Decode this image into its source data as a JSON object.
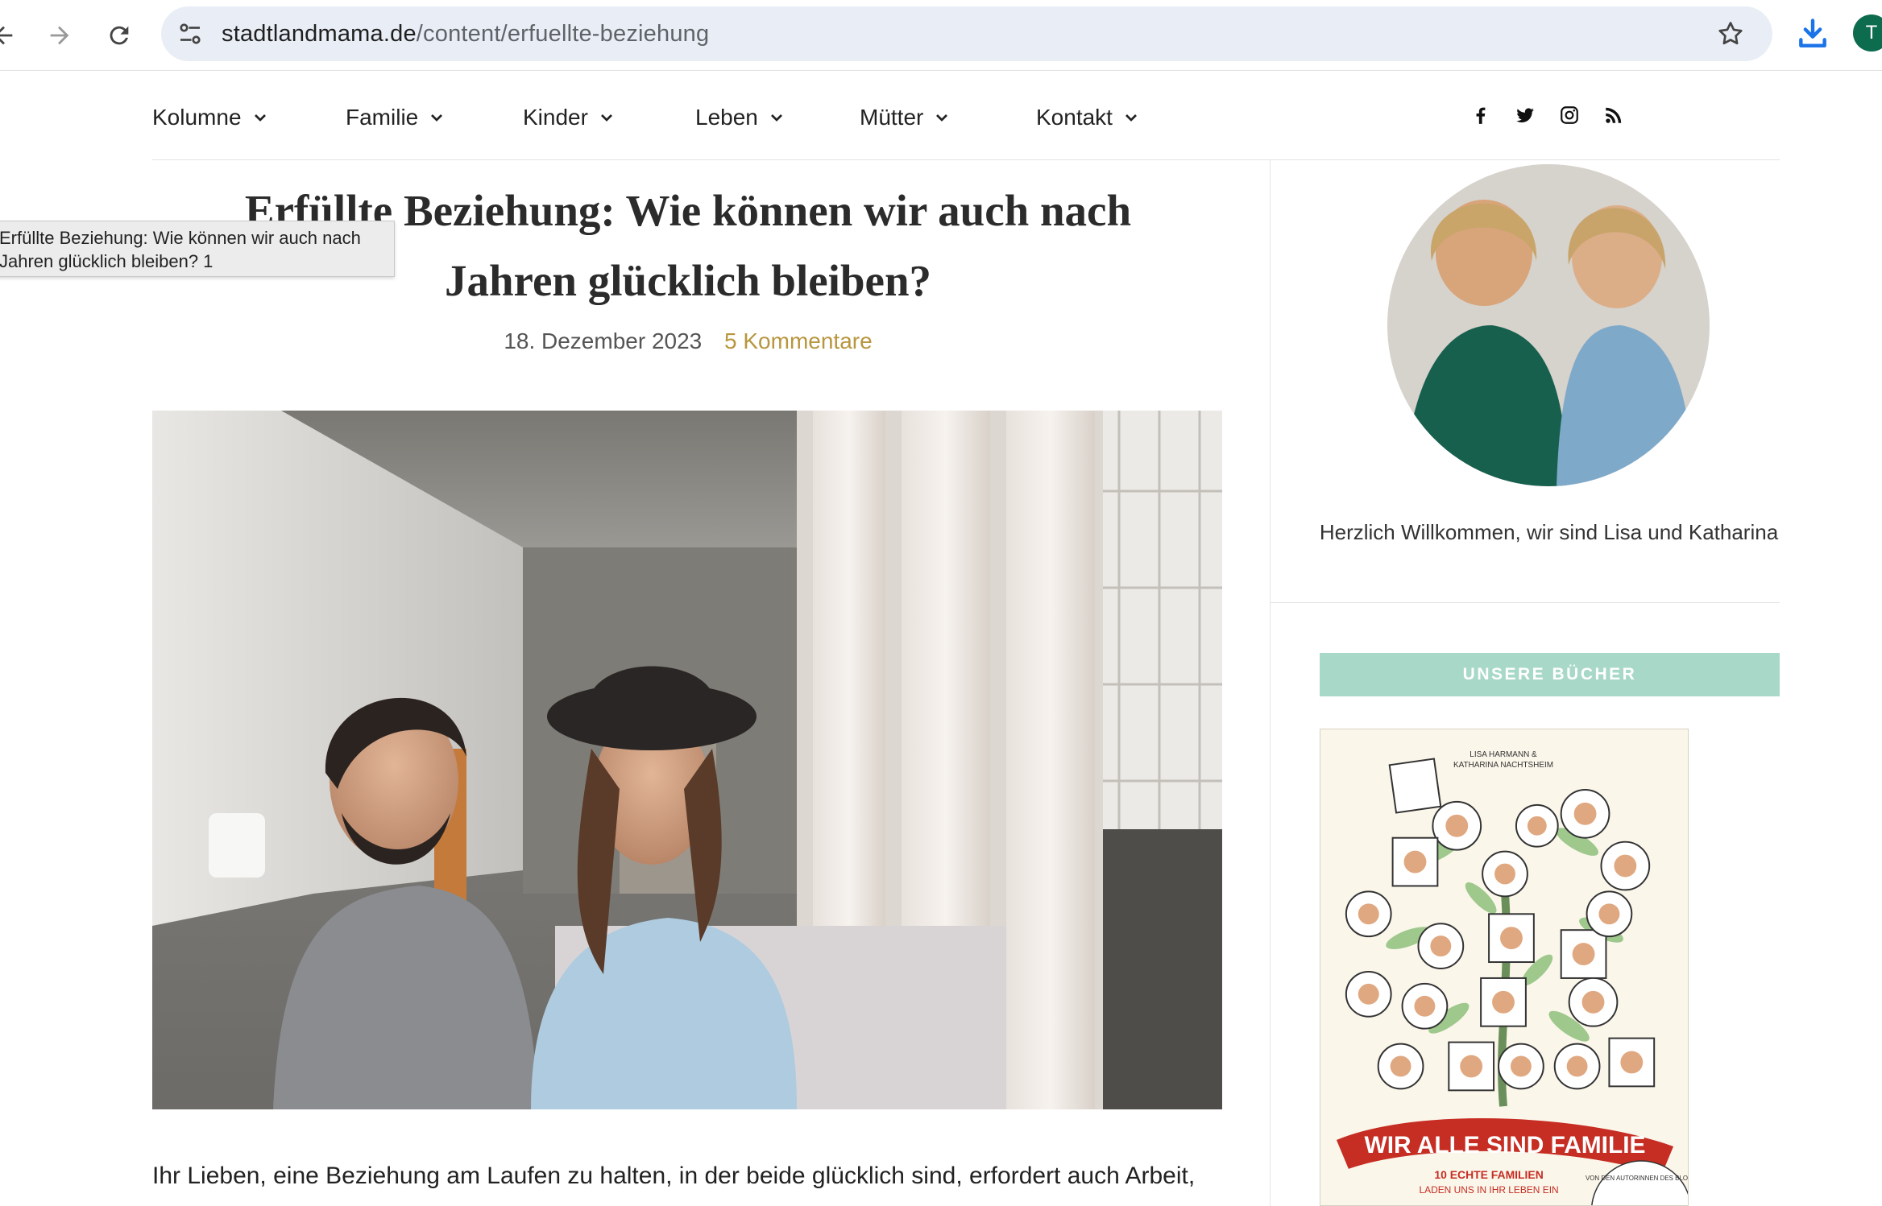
{
  "browser": {
    "url_domain": "stadtlandmama.de",
    "url_path": "/content/erfuellte-beziehung",
    "profile_initial": "T",
    "icons": [
      "back-arrow-icon",
      "forward-arrow-icon",
      "reload-icon",
      "site-settings-icon",
      "bookmark-star-icon",
      "download-icon"
    ]
  },
  "site_nav": {
    "items": [
      {
        "label": "Kolumne"
      },
      {
        "label": "Familie"
      },
      {
        "label": "Kinder"
      },
      {
        "label": "Leben"
      },
      {
        "label": "Mütter"
      },
      {
        "label": "Kontakt"
      }
    ],
    "social": [
      "facebook-icon",
      "twitter-icon",
      "instagram-icon",
      "rss-icon"
    ]
  },
  "article": {
    "title_line1": "Erfüllte Beziehung: Wie können wir auch nach",
    "title_line2": "Jahren glücklich bleiben?",
    "date": "18. Dezember 2023",
    "comments": "5 Kommentare",
    "body_start": "Ihr Lieben, eine Beziehung am Laufen zu halten, in der beide glücklich sind, erfordert auch Arbeit,"
  },
  "tooltip": {
    "line1": "Erfüllte Beziehung: Wie können wir auch nach",
    "line2": "Jahren glücklich bleiben? 1"
  },
  "sidebar": {
    "welcome": "Herzlich Willkommen, wir sind Lisa und Katharina",
    "books_heading": "UNSERE BÜCHER",
    "book": {
      "authors_line1": "LISA HARMANN &",
      "authors_line2": "KATHARINA NACHTSHEIM",
      "title": "WIR ALLE SIND FAMILIE",
      "subtitle_line1": "10 ECHTE FAMILIEN",
      "subtitle_line2": "LADEN UNS IN IHR LEBEN EIN",
      "stamp": "VON DEN AUTORINNEN DES BLOGS"
    }
  },
  "colors": {
    "accent_gold": "#b8963e",
    "banner_mint": "#a8d8c8",
    "book_red": "#c62d23"
  }
}
